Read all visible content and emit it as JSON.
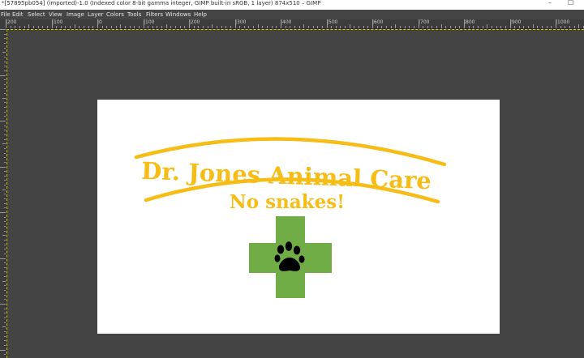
{
  "window": {
    "title": "*[57895pb054] (imported)-1.0 (Indexed color 8-bit gamma integer, GIMP built-in sRGB, 1 layer) 874x510 – GIMP",
    "minimize": "–",
    "maximize": "☐"
  },
  "menubar": {
    "items": [
      "File",
      "Edit",
      "Select",
      "View",
      "Image",
      "Layer",
      "Colors",
      "Tools",
      "Filters",
      "Windows",
      "Help"
    ]
  },
  "ruler": {
    "labels": [
      "|200",
      "|100",
      "|0",
      "|100",
      "|200",
      "|300",
      "|400",
      "|500",
      "|600",
      "|700",
      "|800",
      "|900",
      "|1000"
    ]
  },
  "logo": {
    "title": "Dr. Jones Animal Care",
    "subtitle": "No snakes!"
  },
  "colors": {
    "gold": "#f6bd17",
    "green": "#70ad47",
    "paw": "#000000"
  }
}
